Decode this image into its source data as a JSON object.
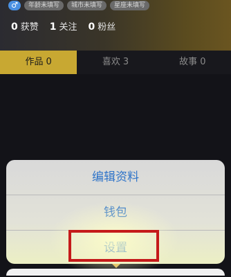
{
  "profile": {
    "gender_symbol": "♂",
    "tags": [
      "年龄未填写",
      "城市未填写",
      "星座未填写"
    ],
    "stats": [
      {
        "num": "0",
        "label": "获赞"
      },
      {
        "num": "1",
        "label": "关注"
      },
      {
        "num": "0",
        "label": "粉丝"
      }
    ]
  },
  "tabs": [
    {
      "label": "作品",
      "count": "0",
      "active": true
    },
    {
      "label": "喜欢",
      "count": "3",
      "active": false
    },
    {
      "label": "故事",
      "count": "0",
      "active": false
    }
  ],
  "action_sheet": {
    "items": [
      "编辑资料",
      "钱包",
      "设置"
    ],
    "highlighted_item": "设置"
  },
  "colors": {
    "accent": "#c8a832",
    "sheet_text": "#2f74c9",
    "highlight_border": "#c51a1a"
  }
}
